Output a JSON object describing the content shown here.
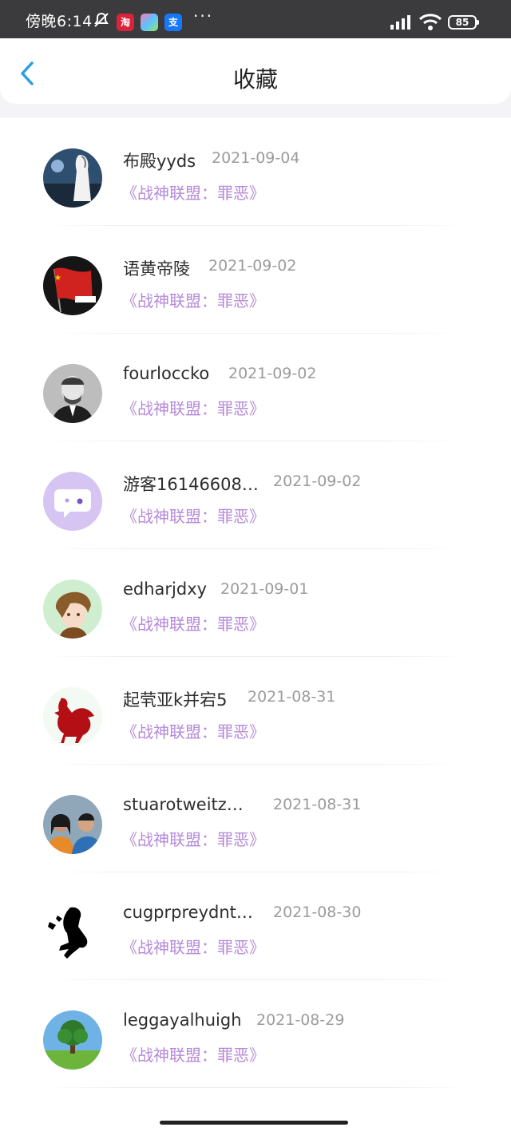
{
  "status_bar": {
    "time": "傍晚6:14",
    "battery": "85",
    "more": "···",
    "apps": [
      "淘",
      "",
      "支"
    ]
  },
  "header": {
    "title": "收藏"
  },
  "favorites": [
    {
      "name": "布殿yyds",
      "date": "2021-09-04",
      "book": "《战神联盟：罪恶》"
    },
    {
      "name": "语黄帝陵",
      "date": "2021-09-02",
      "book": "《战神联盟：罪恶》"
    },
    {
      "name": "fourloccko",
      "date": "2021-09-02",
      "book": "《战神联盟：罪恶》"
    },
    {
      "name": "游客16146608…",
      "date": "2021-09-02",
      "book": "《战神联盟：罪恶》"
    },
    {
      "name": "edharjdxy",
      "date": "2021-09-01",
      "book": "《战神联盟：罪恶》"
    },
    {
      "name": "起茕亚k并宕5",
      "date": "2021-08-31",
      "book": "《战神联盟：罪恶》"
    },
    {
      "name": "stuarotweitz…",
      "date": "2021-08-31",
      "book": "《战神联盟：罪恶》"
    },
    {
      "name": "cugprpreydnt…",
      "date": "2021-08-30",
      "book": "《战神联盟：罪恶》"
    },
    {
      "name": "leggayalhuigh",
      "date": "2021-08-29",
      "book": "《战神联盟：罪恶》"
    }
  ],
  "colors": {
    "accent": "#2a9fe0",
    "book_title": "#b58ad9",
    "date": "#9b9b9b"
  }
}
